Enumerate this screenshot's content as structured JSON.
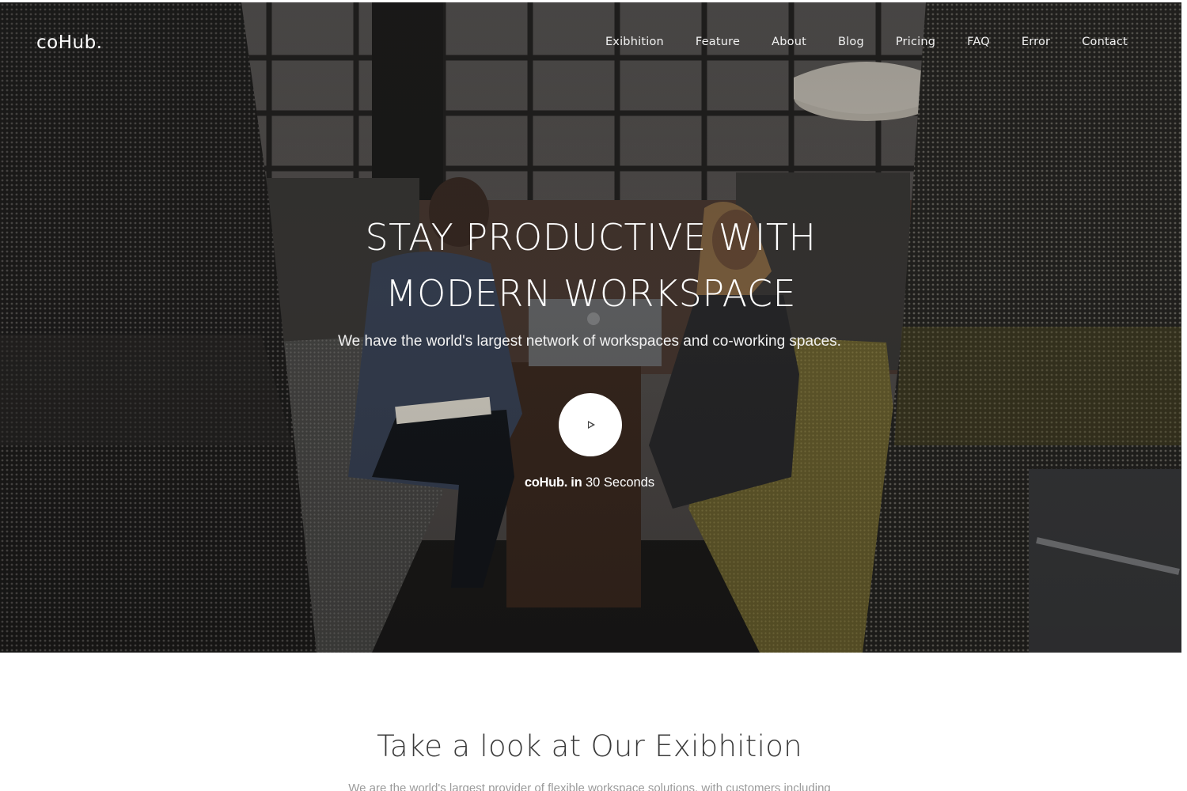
{
  "brand": {
    "logo": "coHub."
  },
  "nav": {
    "items": [
      {
        "label": "Exibhition"
      },
      {
        "label": "Feature"
      },
      {
        "label": "About"
      },
      {
        "label": "Blog"
      },
      {
        "label": "Pricing"
      },
      {
        "label": "FAQ"
      },
      {
        "label": "Error"
      },
      {
        "label": "Contact"
      }
    ]
  },
  "hero": {
    "headline_line1": "STAY PRODUCTIVE WITH",
    "headline_line2": "MODERN WORKSPACE",
    "subline": "We have the world's largest network of workspaces and co-working spaces.",
    "play_icon": "play-icon",
    "caption_brand": "coHub. in",
    "caption_rest": " 30 Seconds",
    "background": "photo of two people working on a laptop in a cushioned booth"
  },
  "section": {
    "title": "Take a look at Our Exibhition",
    "subtitle": "We are the world's largest provider of flexible workspace solutions, with customers including"
  }
}
